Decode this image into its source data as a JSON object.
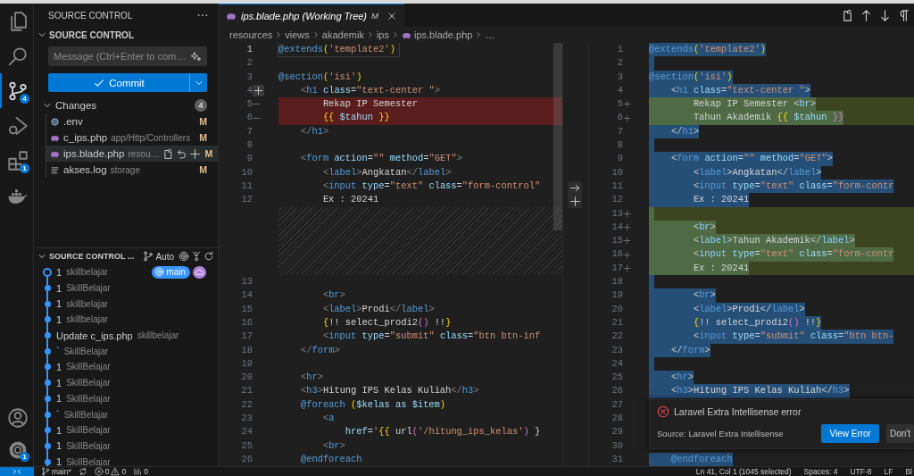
{
  "activity_bar": {
    "items": [
      {
        "kind": "files",
        "selected": false
      },
      {
        "kind": "search",
        "selected": false
      },
      {
        "kind": "source-control",
        "selected": true,
        "badge": "4"
      },
      {
        "kind": "run",
        "selected": false
      },
      {
        "kind": "extensions",
        "selected": false,
        "badge": "1"
      },
      {
        "kind": "docker",
        "selected": false
      }
    ],
    "bottom": [
      {
        "kind": "account"
      },
      {
        "kind": "settings",
        "badge": "1"
      }
    ]
  },
  "sidebar": {
    "title": "SOURCE CONTROL",
    "section": {
      "title": "SOURCE CONTROL",
      "expanded": true
    },
    "message": {
      "placeholder": "Message (Ctrl+Enter to com…"
    },
    "commit_button": {
      "label": "Commit"
    },
    "changes": {
      "title": "Changes",
      "count": "4",
      "expanded": true,
      "files": [
        {
          "kind": "config",
          "name": ".env",
          "status": "M",
          "selected": false
        },
        {
          "kind": "php",
          "name": "c_ips.php",
          "path": "app/Http/Controllers",
          "status": "M",
          "selected": false
        },
        {
          "kind": "php",
          "name": "ips.blade.php",
          "path": "resou…",
          "status": "M",
          "selected": true
        },
        {
          "kind": "log",
          "name": "akses.log",
          "path": "storage",
          "status": "M",
          "selected": false
        }
      ]
    },
    "graph": {
      "title": "SOURCE CONTROL ...",
      "branch_mode": "Auto",
      "expanded": true,
      "commits": [
        {
          "message": "1",
          "author": "skillbelajar",
          "current": true,
          "refs": [
            {
              "kind": "branch",
              "label": "main"
            },
            {
              "kind": "remote"
            }
          ]
        },
        {
          "message": "1",
          "author": "SkillBelajar",
          "current": false
        },
        {
          "message": "1",
          "author": "skillbelajar",
          "current": false
        },
        {
          "message": "1",
          "author": "skillbelajar",
          "current": false
        },
        {
          "message": "Update c_ips.php",
          "author": "skillbelajar",
          "current": false
        },
        {
          "message": "`",
          "author": "SkillBelajar",
          "current": false
        },
        {
          "message": "1",
          "author": "SkillBelajar",
          "current": false
        },
        {
          "message": "1",
          "author": "SkillBelajar",
          "current": false
        },
        {
          "message": "1",
          "author": "SkillBelajar",
          "current": false
        },
        {
          "message": "`",
          "author": "SkillBelajar",
          "current": false
        },
        {
          "message": "1",
          "author": "SkillBelajar",
          "current": false
        },
        {
          "message": "1",
          "author": "SkillBelajar",
          "current": false
        },
        {
          "message": "1",
          "author": "SkillBelajar",
          "current": false
        }
      ]
    }
  },
  "editor": {
    "tab": {
      "title": "ips.blade.php (Working Tree)",
      "status": "M",
      "selected": true
    },
    "breadcrumbs": [
      {
        "kind": "folder",
        "text": "resources"
      },
      {
        "kind": "folder",
        "text": "views"
      },
      {
        "kind": "folder",
        "text": "akademik"
      },
      {
        "kind": "folder",
        "text": "ips"
      },
      {
        "kind": "php",
        "text": "ips.blade.php"
      },
      {
        "kind": "more",
        "text": "…"
      }
    ],
    "original": {
      "lines": [
        {
          "kind": "code",
          "num": "1",
          "current": true,
          "tokens": [
            {
              "kind": "dir",
              "text": "@extends"
            },
            {
              "kind": "brk",
              "text": "("
            },
            {
              "kind": "str",
              "text": "'template2'"
            },
            {
              "kind": "brk",
              "text": ")"
            }
          ]
        },
        {
          "kind": "code",
          "num": "2"
        },
        {
          "kind": "code",
          "num": "3",
          "tokens": [
            {
              "kind": "dir",
              "text": "@section"
            },
            {
              "kind": "brk",
              "text": "("
            },
            {
              "kind": "str",
              "text": "'isi'"
            },
            {
              "kind": "brk",
              "text": ")"
            }
          ]
        },
        {
          "kind": "code",
          "num": "4",
          "gutter_button": true,
          "tokens": [
            {
              "kind": "pun",
              "text": "    <"
            },
            {
              "kind": "tag",
              "text": "h1"
            },
            {
              "kind": "attr",
              "text": " class"
            },
            {
              "kind": "txt",
              "text": "="
            },
            {
              "kind": "str",
              "text": "\"text-center \""
            },
            {
              "kind": "pun",
              "text": ">"
            }
          ]
        },
        {
          "kind": "code",
          "num": "5",
          "removed": true,
          "tokens": [
            {
              "kind": "txt",
              "text": "        Rekap IP Semester"
            }
          ]
        },
        {
          "kind": "code",
          "num": "6",
          "removed": true,
          "tokens": [
            {
              "kind": "brk",
              "text": "        {{"
            },
            {
              "kind": "var",
              "text": " $tahun "
            },
            {
              "kind": "brk",
              "text": "}}"
            }
          ]
        },
        {
          "kind": "code",
          "num": "7",
          "tokens": [
            {
              "kind": "pun",
              "text": "    </"
            },
            {
              "kind": "tag",
              "text": "h1"
            },
            {
              "kind": "pun",
              "text": ">"
            }
          ]
        },
        {
          "kind": "code",
          "num": "8"
        },
        {
          "kind": "code",
          "num": "9",
          "tokens": [
            {
              "kind": "pun",
              "text": "    <"
            },
            {
              "kind": "tag",
              "text": "form"
            },
            {
              "kind": "attr",
              "text": " action"
            },
            {
              "kind": "txt",
              "text": "="
            },
            {
              "kind": "str",
              "text": "\"\""
            },
            {
              "kind": "attr",
              "text": " method"
            },
            {
              "kind": "txt",
              "text": "="
            },
            {
              "kind": "str",
              "text": "\"GET\""
            },
            {
              "kind": "pun",
              "text": ">"
            }
          ]
        },
        {
          "kind": "code",
          "num": "10",
          "tokens": [
            {
              "kind": "pun",
              "text": "        <"
            },
            {
              "kind": "tag",
              "text": "label"
            },
            {
              "kind": "pun",
              "text": ">"
            },
            {
              "kind": "txt",
              "text": "Angkatan"
            },
            {
              "kind": "pun",
              "text": "</"
            },
            {
              "kind": "tag",
              "text": "label"
            },
            {
              "kind": "pun",
              "text": ">"
            }
          ]
        },
        {
          "kind": "code",
          "num": "11",
          "tokens": [
            {
              "kind": "pun",
              "text": "        <"
            },
            {
              "kind": "tag",
              "text": "input"
            },
            {
              "kind": "attr",
              "text": " type"
            },
            {
              "kind": "txt",
              "text": "="
            },
            {
              "kind": "str",
              "text": "\"text\""
            },
            {
              "kind": "attr",
              "text": " class"
            },
            {
              "kind": "txt",
              "text": "="
            },
            {
              "kind": "str",
              "text": "\"form-control\""
            }
          ]
        },
        {
          "kind": "code",
          "num": "12",
          "tokens": [
            {
              "kind": "txt",
              "text": "        Ex : 20241"
            }
          ]
        },
        {
          "kind": "filler"
        },
        {
          "kind": "filler"
        },
        {
          "kind": "filler"
        },
        {
          "kind": "filler"
        },
        {
          "kind": "filler"
        },
        {
          "kind": "code",
          "num": "13"
        },
        {
          "kind": "code",
          "num": "14",
          "tokens": [
            {
              "kind": "pun",
              "text": "        <"
            },
            {
              "kind": "tag",
              "text": "br"
            },
            {
              "kind": "pun",
              "text": ">"
            }
          ]
        },
        {
          "kind": "code",
          "num": "15",
          "tokens": [
            {
              "kind": "pun",
              "text": "        <"
            },
            {
              "kind": "tag",
              "text": "label"
            },
            {
              "kind": "pun",
              "text": ">"
            },
            {
              "kind": "txt",
              "text": "Prodi"
            },
            {
              "kind": "pun",
              "text": "</"
            },
            {
              "kind": "tag",
              "text": "label"
            },
            {
              "kind": "pun",
              "text": ">"
            }
          ]
        },
        {
          "kind": "code",
          "num": "16",
          "tokens": [
            {
              "kind": "brk",
              "text": "        {"
            },
            {
              "kind": "txt",
              "text": "!! select_prodi2"
            },
            {
              "kind": "mag",
              "text": "()"
            },
            {
              "kind": "txt",
              "text": " !!"
            },
            {
              "kind": "brk",
              "text": "}"
            }
          ]
        },
        {
          "kind": "code",
          "num": "17",
          "tokens": [
            {
              "kind": "pun",
              "text": "        <"
            },
            {
              "kind": "tag",
              "text": "input"
            },
            {
              "kind": "attr",
              "text": " type"
            },
            {
              "kind": "txt",
              "text": "="
            },
            {
              "kind": "str",
              "text": "\"submit\""
            },
            {
              "kind": "attr",
              "text": " class"
            },
            {
              "kind": "txt",
              "text": "="
            },
            {
              "kind": "str",
              "text": "\"btn btn-inf"
            }
          ]
        },
        {
          "kind": "code",
          "num": "18",
          "tokens": [
            {
              "kind": "pun",
              "text": "    </"
            },
            {
              "kind": "tag",
              "text": "form"
            },
            {
              "kind": "pun",
              "text": ">"
            }
          ]
        },
        {
          "kind": "code",
          "num": "19"
        },
        {
          "kind": "code",
          "num": "20",
          "tokens": [
            {
              "kind": "pun",
              "text": "    <"
            },
            {
              "kind": "tag",
              "text": "hr"
            },
            {
              "kind": "pun",
              "text": ">"
            }
          ]
        },
        {
          "kind": "code",
          "num": "21",
          "tokens": [
            {
              "kind": "pun",
              "text": "    <"
            },
            {
              "kind": "tag",
              "text": "h3"
            },
            {
              "kind": "pun",
              "text": ">"
            },
            {
              "kind": "txt",
              "text": "Hitung IPS Kelas Kuliah"
            },
            {
              "kind": "pun",
              "text": "</"
            },
            {
              "kind": "tag",
              "text": "h3"
            },
            {
              "kind": "pun",
              "text": ">"
            }
          ]
        },
        {
          "kind": "code",
          "num": "22",
          "tokens": [
            {
              "kind": "dir",
              "text": "    @foreach"
            },
            {
              "kind": "brk",
              "text": " ("
            },
            {
              "kind": "var",
              "text": "$kelas as $item"
            },
            {
              "kind": "brk",
              "text": ")"
            }
          ]
        },
        {
          "kind": "code",
          "num": "23",
          "tokens": [
            {
              "kind": "pun",
              "text": "        <"
            },
            {
              "kind": "tag",
              "text": "a"
            }
          ]
        },
        {
          "kind": "code",
          "num": "24",
          "tokens": [
            {
              "kind": "attr",
              "text": "            href"
            },
            {
              "kind": "txt",
              "text": "="
            },
            {
              "kind": "str",
              "text": "'"
            },
            {
              "kind": "brk",
              "text": "{{"
            },
            {
              "kind": "txt",
              "text": " url"
            },
            {
              "kind": "mag",
              "text": "("
            },
            {
              "kind": "str",
              "text": "'/hitung_ips_kelas'"
            },
            {
              "kind": "mag",
              "text": ")"
            },
            {
              "kind": "txt",
              "text": " }"
            }
          ]
        },
        {
          "kind": "code",
          "num": "25",
          "tokens": [
            {
              "kind": "pun",
              "text": "        <"
            },
            {
              "kind": "tag",
              "text": "br"
            },
            {
              "kind": "pun",
              "text": ">"
            }
          ]
        },
        {
          "kind": "code",
          "num": "26",
          "tokens": [
            {
              "kind": "dir",
              "text": "    @endforeach"
            }
          ]
        }
      ]
    },
    "modified": {
      "lines": [
        {
          "kind": "code",
          "num": "1",
          "selected": true,
          "tokens": [
            {
              "kind": "dir",
              "text": "@extends"
            },
            {
              "kind": "brk",
              "text": "("
            },
            {
              "kind": "str",
              "text": "'template2'"
            },
            {
              "kind": "brk",
              "text": ")"
            }
          ]
        },
        {
          "kind": "code",
          "num": "2",
          "selected": true
        },
        {
          "kind": "code",
          "num": "3",
          "selected": true,
          "tokens": [
            {
              "kind": "dir",
              "text": "@section"
            },
            {
              "kind": "brk",
              "text": "("
            },
            {
              "kind": "str",
              "text": "'isi'"
            },
            {
              "kind": "brk",
              "text": ")"
            }
          ]
        },
        {
          "kind": "code",
          "num": "4",
          "selected": true,
          "tokens": [
            {
              "kind": "pun",
              "text": "    <"
            },
            {
              "kind": "tag",
              "text": "h1"
            },
            {
              "kind": "attr",
              "text": " class"
            },
            {
              "kind": "txt",
              "text": "="
            },
            {
              "kind": "str",
              "text": "\"text-center \""
            },
            {
              "kind": "pun",
              "text": ">"
            }
          ]
        },
        {
          "kind": "code",
          "num": "5",
          "added": true,
          "selected": true,
          "tokens": [
            {
              "kind": "txt",
              "text": "        Rekap IP Semester "
            },
            {
              "kind": "pun",
              "text": "<"
            },
            {
              "kind": "tag",
              "text": "br"
            },
            {
              "kind": "pun",
              "text": ">"
            }
          ]
        },
        {
          "kind": "code",
          "num": "6",
          "added": true,
          "selected": true,
          "tokens": [
            {
              "kind": "txt",
              "text": "        Tahun Akademik "
            },
            {
              "kind": "brk",
              "text": "{{"
            },
            {
              "kind": "var",
              "text": " $tahun "
            },
            {
              "kind": "mag",
              "text": "}}"
            }
          ]
        },
        {
          "kind": "code",
          "num": "7",
          "selected": true,
          "tokens": [
            {
              "kind": "pun",
              "text": "    </"
            },
            {
              "kind": "tag",
              "text": "h1"
            },
            {
              "kind": "pun",
              "text": ">"
            }
          ]
        },
        {
          "kind": "code",
          "num": "8",
          "selected": true
        },
        {
          "kind": "code",
          "num": "9",
          "selected": true,
          "tokens": [
            {
              "kind": "pun",
              "text": "    <"
            },
            {
              "kind": "tag",
              "text": "form"
            },
            {
              "kind": "attr",
              "text": " action"
            },
            {
              "kind": "txt",
              "text": "="
            },
            {
              "kind": "str",
              "text": "\"\""
            },
            {
              "kind": "attr",
              "text": " method"
            },
            {
              "kind": "txt",
              "text": "="
            },
            {
              "kind": "str",
              "text": "\"GET\""
            },
            {
              "kind": "pun",
              "text": ">"
            }
          ]
        },
        {
          "kind": "code",
          "num": "10",
          "selected": true,
          "tokens": [
            {
              "kind": "pun",
              "text": "        <"
            },
            {
              "kind": "tag",
              "text": "label"
            },
            {
              "kind": "pun",
              "text": ">"
            },
            {
              "kind": "txt",
              "text": "Angkatan"
            },
            {
              "kind": "pun",
              "text": "</"
            },
            {
              "kind": "tag",
              "text": "label"
            },
            {
              "kind": "pun",
              "text": ">"
            }
          ]
        },
        {
          "kind": "code",
          "num": "11",
          "selected": true,
          "tokens": [
            {
              "kind": "pun",
              "text": "        <"
            },
            {
              "kind": "tag",
              "text": "input"
            },
            {
              "kind": "attr",
              "text": " type"
            },
            {
              "kind": "txt",
              "text": "="
            },
            {
              "kind": "str",
              "text": "\"text\""
            },
            {
              "kind": "attr",
              "text": " class"
            },
            {
              "kind": "txt",
              "text": "="
            },
            {
              "kind": "str",
              "text": "\"form-contr"
            }
          ]
        },
        {
          "kind": "code",
          "num": "12",
          "selected": true,
          "tokens": [
            {
              "kind": "txt",
              "text": "        Ex : 20241"
            }
          ]
        },
        {
          "kind": "code",
          "num": "13",
          "added": true,
          "selected": true
        },
        {
          "kind": "code",
          "num": "14",
          "added": true,
          "selected": true,
          "tokens": [
            {
              "kind": "pun",
              "text": "        <"
            },
            {
              "kind": "tag",
              "text": "br"
            },
            {
              "kind": "pun",
              "text": ">"
            }
          ]
        },
        {
          "kind": "code",
          "num": "15",
          "added": true,
          "selected": true,
          "tokens": [
            {
              "kind": "pun",
              "text": "        <"
            },
            {
              "kind": "tag",
              "text": "label"
            },
            {
              "kind": "pun",
              "text": ">"
            },
            {
              "kind": "txt",
              "text": "Tahun Akademik"
            },
            {
              "kind": "pun",
              "text": "</"
            },
            {
              "kind": "tag",
              "text": "label"
            },
            {
              "kind": "pun",
              "text": ">"
            }
          ]
        },
        {
          "kind": "code",
          "num": "16",
          "added": true,
          "selected": true,
          "tokens": [
            {
              "kind": "pun",
              "text": "        <"
            },
            {
              "kind": "tag",
              "text": "input"
            },
            {
              "kind": "attr",
              "text": " type"
            },
            {
              "kind": "txt",
              "text": "="
            },
            {
              "kind": "str",
              "text": "\"text\""
            },
            {
              "kind": "attr",
              "text": " class"
            },
            {
              "kind": "txt",
              "text": "="
            },
            {
              "kind": "str",
              "text": "\"form-contr"
            }
          ]
        },
        {
          "kind": "code",
          "num": "17",
          "added": true,
          "selected": true,
          "tokens": [
            {
              "kind": "txt",
              "text": "        Ex : 20241"
            }
          ]
        },
        {
          "kind": "code",
          "num": "18",
          "selected": true
        },
        {
          "kind": "code",
          "num": "19",
          "selected": true,
          "tokens": [
            {
              "kind": "pun",
              "text": "        <"
            },
            {
              "kind": "tag",
              "text": "br"
            },
            {
              "kind": "pun",
              "text": ">"
            }
          ]
        },
        {
          "kind": "code",
          "num": "20",
          "selected": true,
          "tokens": [
            {
              "kind": "pun",
              "text": "        <"
            },
            {
              "kind": "tag",
              "text": "label"
            },
            {
              "kind": "pun",
              "text": ">"
            },
            {
              "kind": "txt",
              "text": "Prodi"
            },
            {
              "kind": "pun",
              "text": "</"
            },
            {
              "kind": "tag",
              "text": "label"
            },
            {
              "kind": "pun",
              "text": ">"
            }
          ]
        },
        {
          "kind": "code",
          "num": "21",
          "selected": true,
          "tokens": [
            {
              "kind": "brk",
              "text": "        {"
            },
            {
              "kind": "txt",
              "text": "!! select_prodi2"
            },
            {
              "kind": "mag",
              "text": "()"
            },
            {
              "kind": "txt",
              "text": " !!"
            },
            {
              "kind": "brk",
              "text": "}"
            }
          ]
        },
        {
          "kind": "code",
          "num": "22",
          "selected": true,
          "tokens": [
            {
              "kind": "pun",
              "text": "        <"
            },
            {
              "kind": "tag",
              "text": "input"
            },
            {
              "kind": "attr",
              "text": " type"
            },
            {
              "kind": "txt",
              "text": "="
            },
            {
              "kind": "str",
              "text": "\"submit\""
            },
            {
              "kind": "attr",
              "text": " class"
            },
            {
              "kind": "txt",
              "text": "="
            },
            {
              "kind": "str",
              "text": "\"btn btn-"
            }
          ]
        },
        {
          "kind": "code",
          "num": "23",
          "selected": true,
          "tokens": [
            {
              "kind": "pun",
              "text": "    </"
            },
            {
              "kind": "tag",
              "text": "form"
            },
            {
              "kind": "pun",
              "text": ">"
            }
          ]
        },
        {
          "kind": "code",
          "num": "24",
          "selected": true
        },
        {
          "kind": "code",
          "num": "25",
          "selected": true,
          "tokens": [
            {
              "kind": "pun",
              "text": "    <"
            },
            {
              "kind": "tag",
              "text": "hr"
            },
            {
              "kind": "pun",
              "text": ">"
            }
          ]
        },
        {
          "kind": "code",
          "num": "26",
          "selected": true,
          "tokens": [
            {
              "kind": "pun",
              "text": "    <"
            },
            {
              "kind": "tag",
              "text": "h3"
            },
            {
              "kind": "pun",
              "text": ">"
            },
            {
              "kind": "txt",
              "text": "Hitung IPS Kelas Kuliah"
            },
            {
              "kind": "pun",
              "text": "</"
            },
            {
              "kind": "tag",
              "text": "h3"
            },
            {
              "kind": "pun",
              "text": ">"
            }
          ]
        },
        {
          "kind": "code",
          "num": "27"
        },
        {
          "kind": "code",
          "num": "28"
        },
        {
          "kind": "code",
          "num": "29"
        },
        {
          "kind": "code",
          "num": "30"
        },
        {
          "kind": "code",
          "num": "31",
          "selected": true,
          "tokens": [
            {
              "kind": "dir",
              "text": "    @endforeach"
            }
          ]
        }
      ]
    }
  },
  "notification": {
    "title": "Laravel Extra Intellisense error",
    "source": "Source: Laravel Extra Intellisense",
    "buttons": [
      {
        "label": "View Error",
        "primary": true
      },
      {
        "label": "Don't",
        "primary": false
      }
    ]
  },
  "status_bar": {
    "branch": "main*",
    "errors": "0",
    "warnings": "0",
    "ports": "0",
    "right": [
      "Ln 41, Col 1 (1045 selected)",
      "Spaces: 4",
      "UTF-8",
      "LF",
      "Bl"
    ]
  }
}
